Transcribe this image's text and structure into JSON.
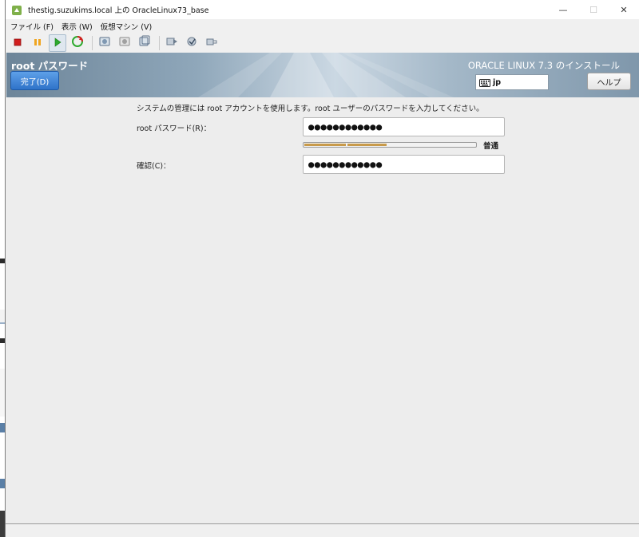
{
  "window": {
    "title": "thestig.suzukims.local 上の OracleLinux73_base",
    "controls": {
      "minimize": "—",
      "maximize": "☐",
      "close": "✕"
    }
  },
  "menubar": [
    {
      "label": "ファイル (F)"
    },
    {
      "label": "表示 (W)"
    },
    {
      "label": "仮想マシン (V)"
    }
  ],
  "toolbar": {
    "icons": [
      "stop-icon",
      "pause-icon",
      "play-icon",
      "refresh-icon",
      "snapshot-icon",
      "revert-snapshot-icon",
      "manage-snapshot-icon",
      "send-keys-icon",
      "settings-icon",
      "connect-device-icon"
    ]
  },
  "installer": {
    "header_title": "root パスワード",
    "done_label": "完了(D)",
    "product_title": "ORACLE LINUX 7.3 のインストール",
    "keyboard_layout": "jp",
    "help_label": "ヘルプ",
    "instruction": "システムの管理には root アカウントを使用します。root ユーザーのパスワードを入力してください。",
    "password_label": "root パスワード(R)：",
    "password_value": "●●●●●●●●●●●●",
    "strength_label": "普通",
    "strength_fraction": 0.48,
    "confirm_label": "確認(C)：",
    "confirm_value": "●●●●●●●●●●●●"
  },
  "colors": {
    "accent_button": "#2f73c9",
    "strength_bar": "#c89a4a",
    "installer_bg": "#ededed"
  }
}
